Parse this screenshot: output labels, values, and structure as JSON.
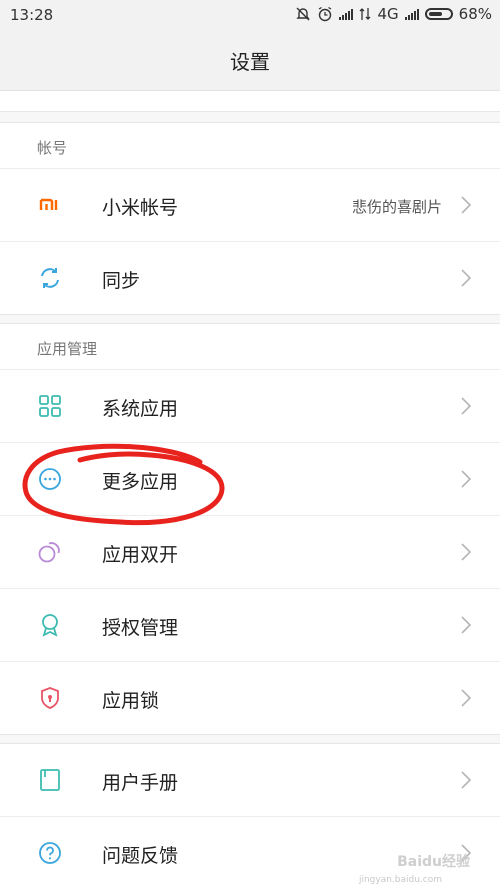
{
  "status_bar": {
    "time": "13:28",
    "network": "4G",
    "battery": "68%",
    "battery_level": 0.68
  },
  "header": {
    "title": "设置"
  },
  "account_section": {
    "title": "帐号",
    "items": [
      {
        "label": "小米帐号",
        "value": "悲伤的喜剧片",
        "icon": "mi-logo-icon"
      },
      {
        "label": "同步",
        "icon": "sync-icon"
      }
    ]
  },
  "apps_section": {
    "title": "应用管理",
    "items": [
      {
        "label": "系统应用",
        "icon": "grid-icon"
      },
      {
        "label": "更多应用",
        "icon": "more-dots-icon"
      },
      {
        "label": "应用双开",
        "icon": "dual-app-icon"
      },
      {
        "label": "授权管理",
        "icon": "permission-badge-icon"
      },
      {
        "label": "应用锁",
        "icon": "shield-lock-icon"
      }
    ]
  },
  "help_section": {
    "items": [
      {
        "label": "用户手册",
        "icon": "manual-icon"
      },
      {
        "label": "问题反馈",
        "icon": "help-icon"
      }
    ]
  },
  "colors": {
    "mi_orange": "#ff6a00",
    "teal": "#3dbbb0",
    "purple": "#b98ad9",
    "red": "#e85566",
    "annotation_red": "#e8231d"
  },
  "watermark": {
    "text": "Baidu经验",
    "url": "jingyan.baidu.com"
  }
}
